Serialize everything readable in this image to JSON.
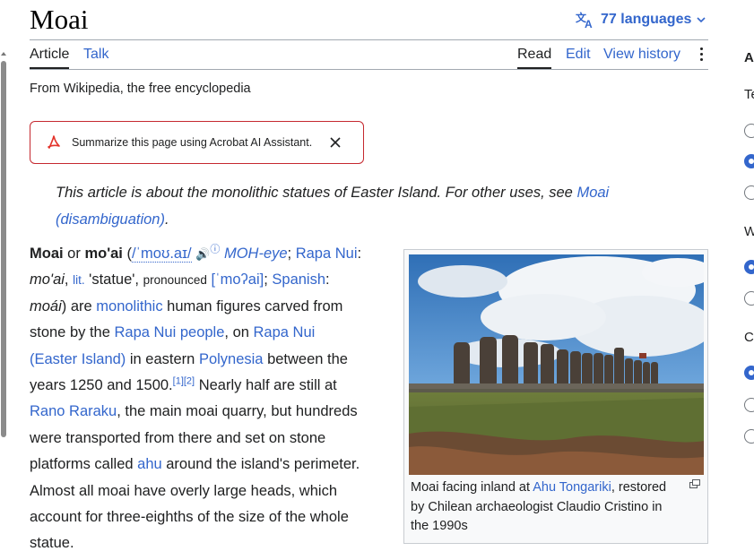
{
  "page": {
    "title": "Moai",
    "languages_label": "77 languages",
    "tagline": "From Wikipedia, the free encyclopedia"
  },
  "tabs": {
    "article": "Article",
    "talk": "Talk",
    "read": "Read",
    "edit": "Edit",
    "view_history": "View history"
  },
  "acrobat": {
    "text": "Summarize this page using Acrobat AI Assistant."
  },
  "hatnote": {
    "text": "This article is about the monolithic statues of Easter Island. For other uses, see ",
    "link": "Moai (disambiguation)",
    "end": "."
  },
  "lead": {
    "moai": "Moai",
    "or": " or ",
    "moai_alt": "mo'ai",
    "ipa_open": " (",
    "ipa": "/ˈmoʊ.aɪ/",
    "speaker": "🔊",
    "info": "ⓘ",
    "respell": "MOH-eye",
    "sep": "; ",
    "rapa_nui": "Rapa Nui",
    "colon": ": ",
    "moai_native": "mo'ai",
    "comma": ", ",
    "lit": "lit.",
    "statue": " 'statue', ",
    "pronounced": "pronounced",
    "ipa2": "[ˈmoʔai]",
    "semi": ";",
    "spanish": "Spanish",
    "colon2": ": ",
    "moai_es": "moái",
    "are": ") are ",
    "monolithic": "monolithic",
    "t1": " human figures carved from stone by the ",
    "rapa_nui_people": "Rapa Nui people",
    "t2": ", on ",
    "easter_island": "Rapa Nui (Easter Island)",
    "t3": " in eastern ",
    "polynesia": "Polynesia",
    "t4": " between the years 1250 and 1500.",
    "ref1": "[1]",
    "ref2": "[2]",
    "t5": " Nearly half are still at ",
    "rano_raraku": "Rano Raraku",
    "t6": ", the main moai quarry, but hundreds were transported from there and set on stone platforms called ",
    "ahu": "ahu",
    "t7": " around the island's perimeter. Almost all moai have overly large heads, which account for three-eighths of the size of the whole statue."
  },
  "figure": {
    "caption_pre": "Moai facing inland at ",
    "caption_link": "Ahu Tongariki",
    "caption_post": ", restored by Chilean archaeologist Claudio Cristino in the 1990s"
  },
  "sidebar": {
    "heading": "A",
    "text_label": "Te",
    "width_label": "W",
    "color_label": "C"
  },
  "colors": {
    "link": "#3366cc",
    "acrobat_red": "#c5282f",
    "text": "#202122"
  },
  "icons": [
    "translate-icon",
    "chevron-down-icon",
    "more-vertical-icon",
    "acrobat-icon",
    "close-icon",
    "speaker-icon",
    "enlarge-icon"
  ]
}
